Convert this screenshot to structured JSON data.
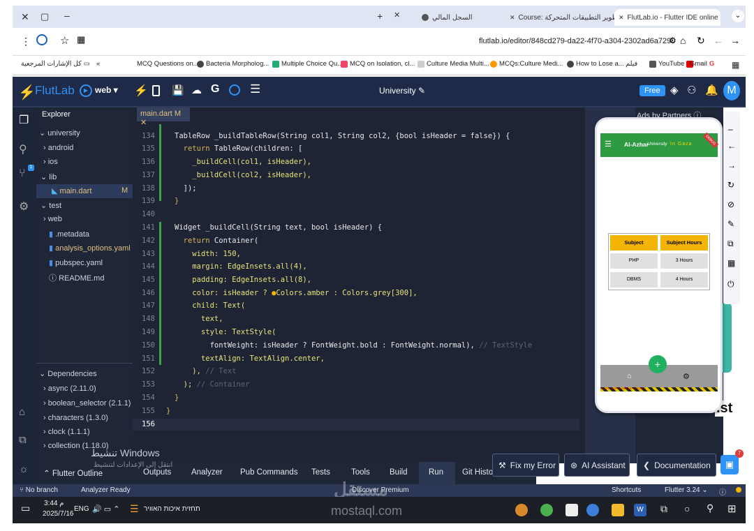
{
  "tabs": [
    {
      "title": "FlutLab.io - Flutter IDE online",
      "active": true
    },
    {
      "title": "Course: تطوير التطبيقات المتحركة",
      "active": false
    },
    {
      "title": "السجل المالي",
      "active": false
    }
  ],
  "address": {
    "url": "flutlab.io/editor/848cd279-da22-4f70-a304-2302ad6a7290"
  },
  "bookmarks": {
    "all_label": "كل الإشارات المرجعية",
    "items": [
      "MCQ Questions on...",
      "Bacteria Morpholog...",
      "Multiple Choice Qu...",
      "MCQ on Isolation, cl...",
      "Culture Media Multi...",
      "MCQs:Culture Medi...",
      "How to Lose a... فيلم",
      "YouTube",
      "Gmail"
    ]
  },
  "app": {
    "logo": "FlutLab",
    "platform": "web",
    "project": "University",
    "plan": "Free",
    "avatar": "M"
  },
  "explorer": {
    "title": "Explorer",
    "items": [
      "university",
      "android",
      "ios",
      "lib",
      "main.dart",
      "M",
      "test",
      "web",
      ".metadata",
      "analysis_options.yaml",
      "pubspec.yaml",
      "README.md"
    ],
    "deps_title": "Dependencies",
    "deps": [
      "async (2.11.0)",
      "boolean_selector (2.1.1)",
      "characters (1.3.0)",
      "clock (1.1.1)",
      "collection (1.18.0)"
    ]
  },
  "editor": {
    "tab": "main.dart M",
    "line_numbers": [
      "134",
      "135",
      "136",
      "137",
      "138",
      "139",
      "140",
      "141",
      "142",
      "143",
      "144",
      "145",
      "146",
      "147",
      "148",
      "149",
      "150",
      "151",
      "152",
      "153",
      "154",
      "155",
      "156"
    ]
  },
  "preview": {
    "ads": "Ads by Partners",
    "app_title": "Al-Azhar",
    "app_subtitle": "University",
    "app_city": "In Gaza",
    "debug": "DEBUG",
    "headers": [
      "Subject",
      "Subject Hours"
    ],
    "rows": [
      [
        "PHP",
        "3 Hours"
      ],
      [
        "DBMS",
        "4 Hours"
      ]
    ],
    "fab": "+",
    "overflow": "BOTTOM OVERFLOWED BY 12 PIXELS"
  },
  "bottom_tabs": [
    "Flutter Outline",
    "Outputs",
    "Analyzer",
    "Pub Commands",
    "Tests",
    "Tools",
    "Build",
    "Run",
    "Git History"
  ],
  "actions": {
    "fix": "Fix my Error",
    "ai": "AI Assistant",
    "docs": "Documentation",
    "badge": "7"
  },
  "watermark": {
    "activate": "تنشيط Windows",
    "settings": "انتقل إلى الإعدادات لتنشيط",
    "site": "mostaql.com",
    "site_ar": "مستقل"
  },
  "status": {
    "branch": "No branch",
    "analyzer": "Analyzer Ready",
    "premium": "Discover Premium",
    "shortcuts": "Shortcuts",
    "version": "Flutter 3.24"
  },
  "taskbar": {
    "time": "3:44 م",
    "date": "2025/7/16",
    "lang": "ENG",
    "news": "תחזית איכות האוויר"
  },
  "colors": {
    "header_bg": "#1e2a48",
    "editor_bg": "#1e2434",
    "accent": "#2f93f5",
    "amber": "#f5b400"
  }
}
